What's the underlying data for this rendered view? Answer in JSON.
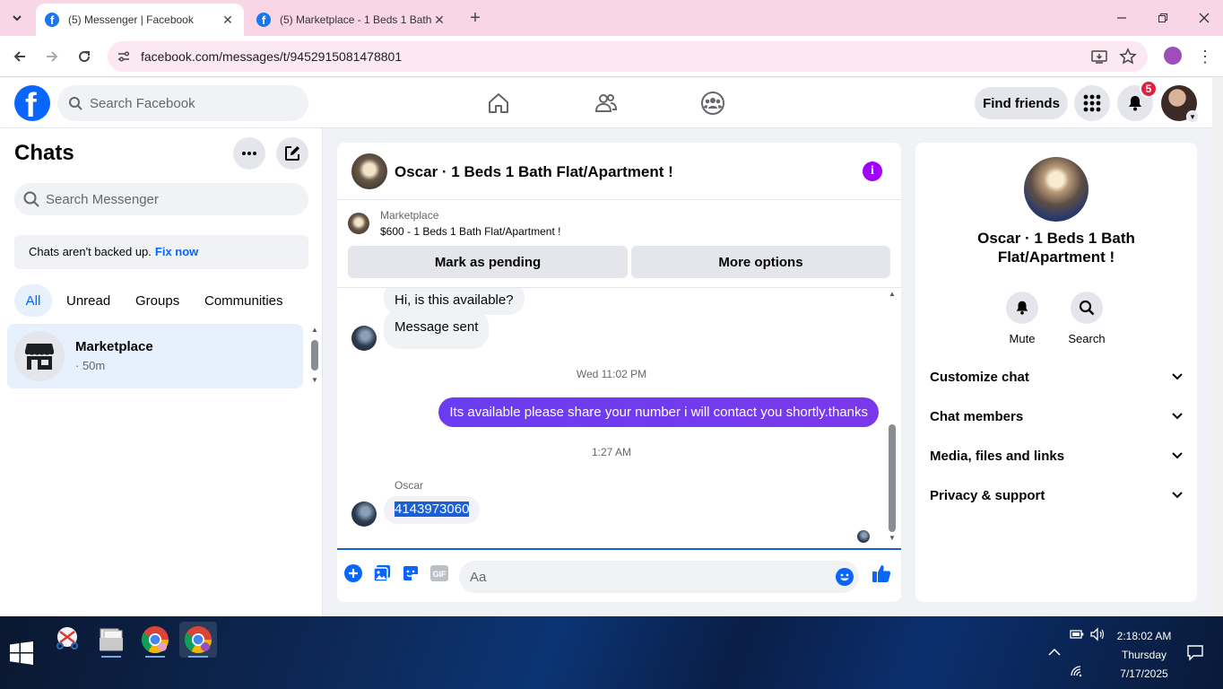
{
  "browser": {
    "tabs": [
      {
        "title": "(5) Messenger | Facebook",
        "active": true
      },
      {
        "title": "(5) Marketplace - 1 Beds 1 Bath",
        "active": false
      }
    ],
    "url": "facebook.com/messages/t/9452915081478801"
  },
  "fb": {
    "logo_letter": "f",
    "search_placeholder": "Search Facebook",
    "find_friends": "Find friends",
    "notifications_count": "5"
  },
  "chats": {
    "title": "Chats",
    "search_placeholder": "Search Messenger",
    "backup_text": "Chats aren't backed up.",
    "backup_link": "Fix now",
    "filters": [
      "All",
      "Unread",
      "Groups",
      "Communities"
    ],
    "items": [
      {
        "name": "Marketplace",
        "meta": "· 50m"
      }
    ]
  },
  "conversation": {
    "title": "Oscar · 1 Beds 1 Bath Flat/Apartment !",
    "info_glyph": "i",
    "marketplace_label": "Marketplace",
    "listing": "$600 - 1 Beds 1 Bath Flat/Apartment !",
    "mark_pending": "Mark as pending",
    "more_options": "More options",
    "messages": {
      "in1": "Hi, is this available?",
      "in2": "Message sent",
      "ts1": "Wed 11:02 PM",
      "out1": "Its  available please share your number i will contact you shortly.thanks",
      "ts2": "1:27 AM",
      "sender": "Oscar",
      "in3": "4143973060"
    },
    "composer_placeholder": "Aa"
  },
  "info_panel": {
    "name_line1": "Oscar · 1 Beds 1 Bath",
    "name_line2": "Flat/Apartment !",
    "actions": [
      "Mute",
      "Search"
    ],
    "sections": [
      "Customize chat",
      "Chat members",
      "Media, files and links",
      "Privacy & support"
    ]
  },
  "taskbar": {
    "time": "2:18:02 AM",
    "day": "Thursday",
    "date": "7/17/2025"
  },
  "colors": {
    "fb_blue": "#0866ff",
    "outgoing_bubble": "#6a3df2",
    "info_purple": "#a100ff",
    "badge_red": "#e41e3f"
  }
}
